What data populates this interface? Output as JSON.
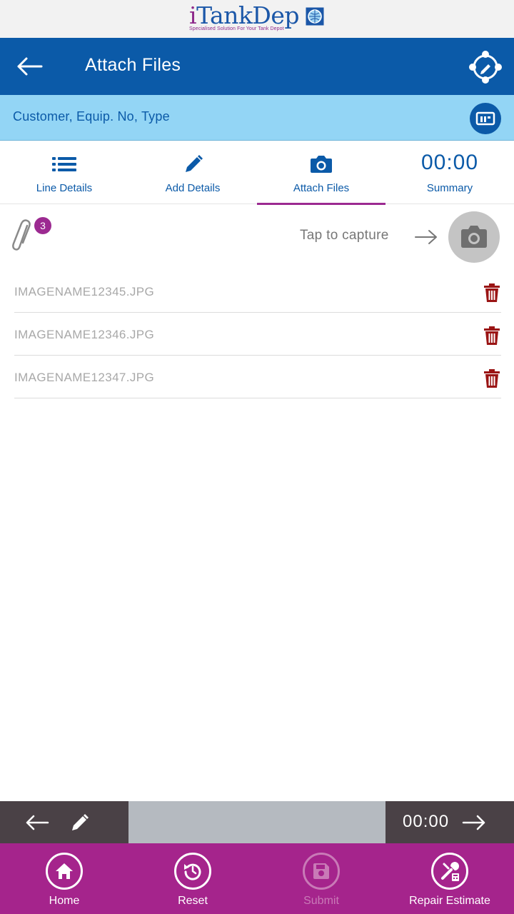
{
  "logo": {
    "text_prefix": "i",
    "text_main": "TankDep",
    "tagline": "Specialised Solution For Your Tank Depot"
  },
  "header": {
    "title": "Attach Files",
    "back_icon": "arrow-left-icon",
    "action_icon": "edit-network-icon"
  },
  "info_bar": {
    "text": "Customer, Equip. No, Type",
    "icon": "id-card-icon"
  },
  "tabs": [
    {
      "label": "Line Details",
      "icon": "list-icon"
    },
    {
      "label": "Add Details",
      "icon": "pencil-icon"
    },
    {
      "label": "Attach Files",
      "icon": "camera-icon",
      "active": true
    },
    {
      "label": "Summary",
      "value": "00:00"
    }
  ],
  "capture": {
    "attachment_count": "3",
    "tap_text": "Tap to capture"
  },
  "files": [
    {
      "name": "IMAGENAME12345.JPG"
    },
    {
      "name": "IMAGENAME12346.JPG"
    },
    {
      "name": "IMAGENAME12347.JPG"
    }
  ],
  "action_strip": {
    "timer": "00:00"
  },
  "bottom_nav": [
    {
      "label": "Home",
      "icon": "home-icon",
      "enabled": true
    },
    {
      "label": "Reset",
      "icon": "reset-icon",
      "enabled": true
    },
    {
      "label": "Submit",
      "icon": "save-icon",
      "enabled": false
    },
    {
      "label": "Repair Estimate",
      "icon": "repair-estimate-icon",
      "enabled": true
    }
  ],
  "colors": {
    "primary_blue": "#0b5aa8",
    "info_bar_blue": "#93d5f5",
    "accent_purple": "#a5248c",
    "delete_red": "#9a1414"
  }
}
